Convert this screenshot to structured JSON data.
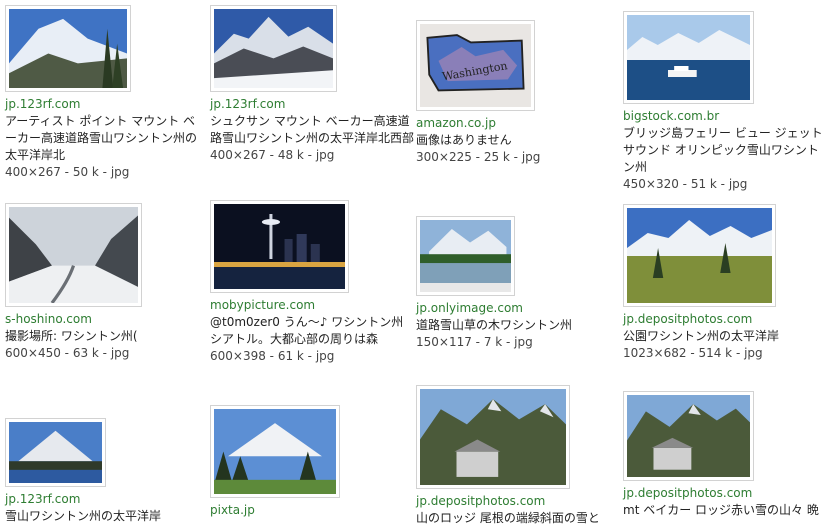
{
  "results": [
    {
      "source": "jp.123rf.com",
      "desc": "アーティスト ポイント マウント ベーカー高速道路雪山ワシントン州の太平洋岸北",
      "size": "400×267 - 50 k - jpg",
      "thumb": "snowy-mountain-icon"
    },
    {
      "source": "jp.123rf.com",
      "desc": "シュクサン マウント ベーカー高速道路雪山ワシントン州の太平洋岸北西部",
      "size": "400×267 - 48 k - jpg",
      "thumb": "snowy-peaks-icon"
    },
    {
      "source": "amazon.co.jp",
      "desc": "画像はありません",
      "size": "300×225 - 25 k - jpg",
      "thumb": "washington-pin-icon"
    },
    {
      "source": "bigstock.com.br",
      "desc": "ブリッジ島フェリー ビュー ジェット サウンド オリンピック雪山ワシントン州",
      "size": "450×320 - 51 k - jpg",
      "thumb": "ferry-icon"
    },
    {
      "source": "s-hoshino.com",
      "desc": "撮影場所: ワシントン州(",
      "size": "600×450 - 63 k - jpg",
      "thumb": "snow-valley-icon"
    },
    {
      "source": "mobypicture.com",
      "desc": "@t0m0zer0 うん〜♪ ワシントン州シアトル。大都心部の周りは森",
      "size": "600×398 - 61 k - jpg",
      "thumb": "seattle-night-icon"
    },
    {
      "source": "jp.onlyimage.com",
      "desc": "道路雪山草の木ワシントン州",
      "size": "150×117 - 7 k - jpg",
      "thumb": "mountain-lake-icon"
    },
    {
      "source": "jp.depositphotos.com",
      "desc": "公園ワシントン州の太平洋岸",
      "size": "1023×682 - 514 k - jpg",
      "thumb": "alpine-meadow-icon"
    },
    {
      "source": "jp.123rf.com",
      "desc": "雪山ワシントン州の太平洋岸",
      "size": "",
      "thumb": "rainier-lake-icon"
    },
    {
      "source": "pixta.jp",
      "desc": "",
      "size": "",
      "thumb": "rainier-forest-icon"
    },
    {
      "source": "jp.depositphotos.com",
      "desc": "山のロッジ 尾根の端緑斜面の雪と",
      "size": "",
      "thumb": "lodge-mountain-icon"
    },
    {
      "source": "jp.depositphotos.com",
      "desc": "mt ベイカー ロッジ赤い雪の山々 晩",
      "size": "",
      "thumb": "lodge-mountain-icon-2"
    }
  ]
}
